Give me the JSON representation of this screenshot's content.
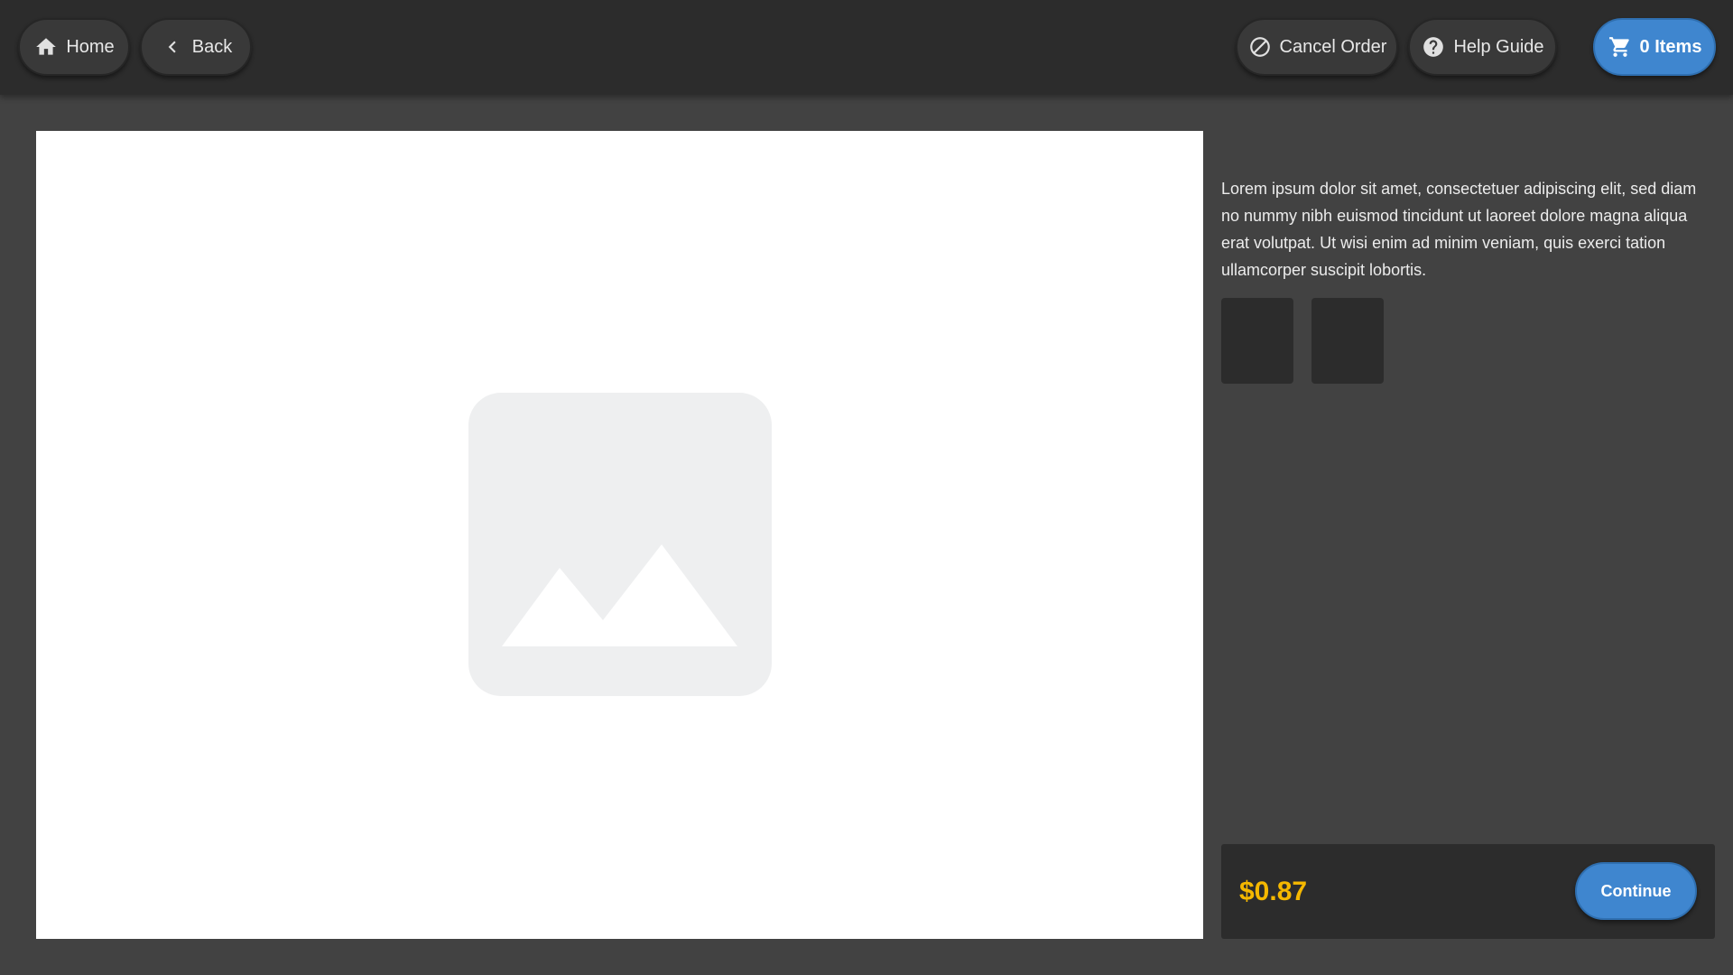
{
  "header": {
    "home_label": "Home",
    "back_label": "Back",
    "cancel_label": "Cancel Order",
    "help_label": "Help Guide",
    "cart_label": "0 Items"
  },
  "product": {
    "description": "Lorem ipsum dolor sit amet, consectetuer adipiscing elit, sed diam no nummy nibh euismod tincidunt ut laoreet dolore magna aliqua erat volutpat. Ut wisi enim ad minim veniam, quis exerci tation ullamcorper suscipit lobortis."
  },
  "footer": {
    "price": "$0.87",
    "continue_label": "Continue"
  },
  "colors": {
    "accent": "#3f86cf",
    "price": "#f5b800",
    "topbar": "#2c2c2c",
    "background": "#424242"
  },
  "icons": {
    "home": "home-icon",
    "back": "chevron-left-icon",
    "cancel": "block-icon",
    "help": "help-circle-icon",
    "cart": "cart-icon",
    "image": "image-placeholder-icon"
  }
}
